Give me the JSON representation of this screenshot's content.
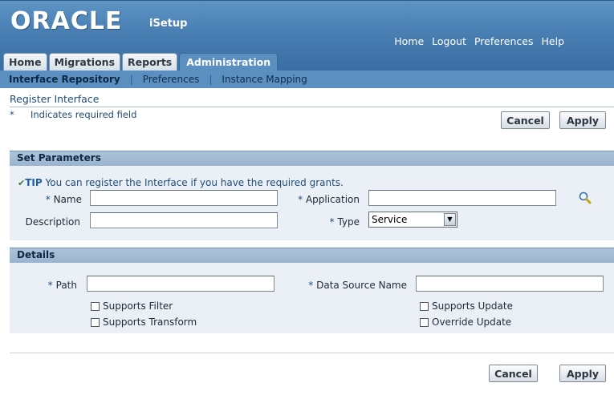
{
  "header": {
    "logo": "ORACLE",
    "app_name": "iSetup",
    "global_links": [
      "Home",
      "Logout",
      "Preferences",
      "Help"
    ]
  },
  "tabs": [
    {
      "label": "Home"
    },
    {
      "label": "Migrations"
    },
    {
      "label": "Reports"
    },
    {
      "label": "Administration",
      "active": true
    }
  ],
  "subtabs": [
    {
      "label": "Interface Repository",
      "active": true
    },
    {
      "label": "Preferences"
    },
    {
      "label": "Instance Mapping"
    }
  ],
  "page": {
    "title": "Register Interface",
    "required_star": "*",
    "required_note": "Indicates required field",
    "cancel_label": "Cancel",
    "apply_label": "Apply"
  },
  "set_parameters": {
    "title": "Set Parameters",
    "tip_label": "TIP",
    "tip_text": "You can register the Interface if you have the required grants.",
    "name_label": "Name",
    "application_label": "Application",
    "description_label": "Description",
    "type_label": "Type",
    "required_marker": "*",
    "name_value": "",
    "application_value": "",
    "description_value": "",
    "type_selected": "Service"
  },
  "details": {
    "title": "Details",
    "path_label": "Path",
    "data_source_label": "Data Source Name",
    "required_marker": "*",
    "path_value": "",
    "data_source_value": "",
    "supports_filter": "Supports Filter",
    "supports_transform": "Supports Transform",
    "supports_update": "Supports Update",
    "override_update": "Override Update"
  },
  "colors": {
    "header_blue": "#4a80b4",
    "section_head": "#9ab4cf",
    "section_body": "#eaf0f6",
    "link_text": "#1f4c78"
  }
}
